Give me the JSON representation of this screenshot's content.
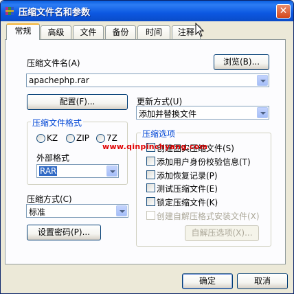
{
  "window": {
    "title": "压缩文件名和参数",
    "close_glyph": "✕"
  },
  "tabs": [
    {
      "label": "常规"
    },
    {
      "label": "高级"
    },
    {
      "label": "文件"
    },
    {
      "label": "备份"
    },
    {
      "label": "时间"
    },
    {
      "label": "注释"
    }
  ],
  "archive_name": {
    "label": "压缩文件名(A)",
    "value": "apachephp.rar",
    "browse_button": "浏览(B)..."
  },
  "config_button": "配置(F)...",
  "update_mode": {
    "label": "更新方式(U)",
    "value": "添加并替换文件"
  },
  "archive_format": {
    "legend": "压缩文件格式",
    "options": [
      "KZ",
      "ZIP",
      "7Z"
    ],
    "external_label": "外部格式",
    "external_value": "RAR"
  },
  "compression_method": {
    "label": "压缩方式(C)",
    "value": "标准"
  },
  "password_button": "设置密码(P)...",
  "compression_options": {
    "legend": "压缩选项",
    "items": [
      {
        "label": "创建固实压缩文件(S)",
        "checked": false,
        "enabled": true
      },
      {
        "label": "添加用户身份校验信息(T)",
        "checked": false,
        "enabled": true
      },
      {
        "label": "添加恢复记录(P)",
        "checked": false,
        "enabled": true
      },
      {
        "label": "测试压缩文件(E)",
        "checked": false,
        "enabled": true
      },
      {
        "label": "锁定压缩文件(K)",
        "checked": false,
        "enabled": true
      },
      {
        "label": "创建自解压格式安装文件(X)",
        "checked": false,
        "enabled": false
      }
    ],
    "sfx_button": "自解压选项(X)..."
  },
  "watermark": "www.qinpinchyang.com",
  "footer": {
    "ok_button": "确定",
    "cancel_button": "取消"
  },
  "colors": {
    "titlebar": "#0a5fe0",
    "legend_text": "#0046d5",
    "selection": "#316ac5",
    "watermark": "#e00000"
  }
}
